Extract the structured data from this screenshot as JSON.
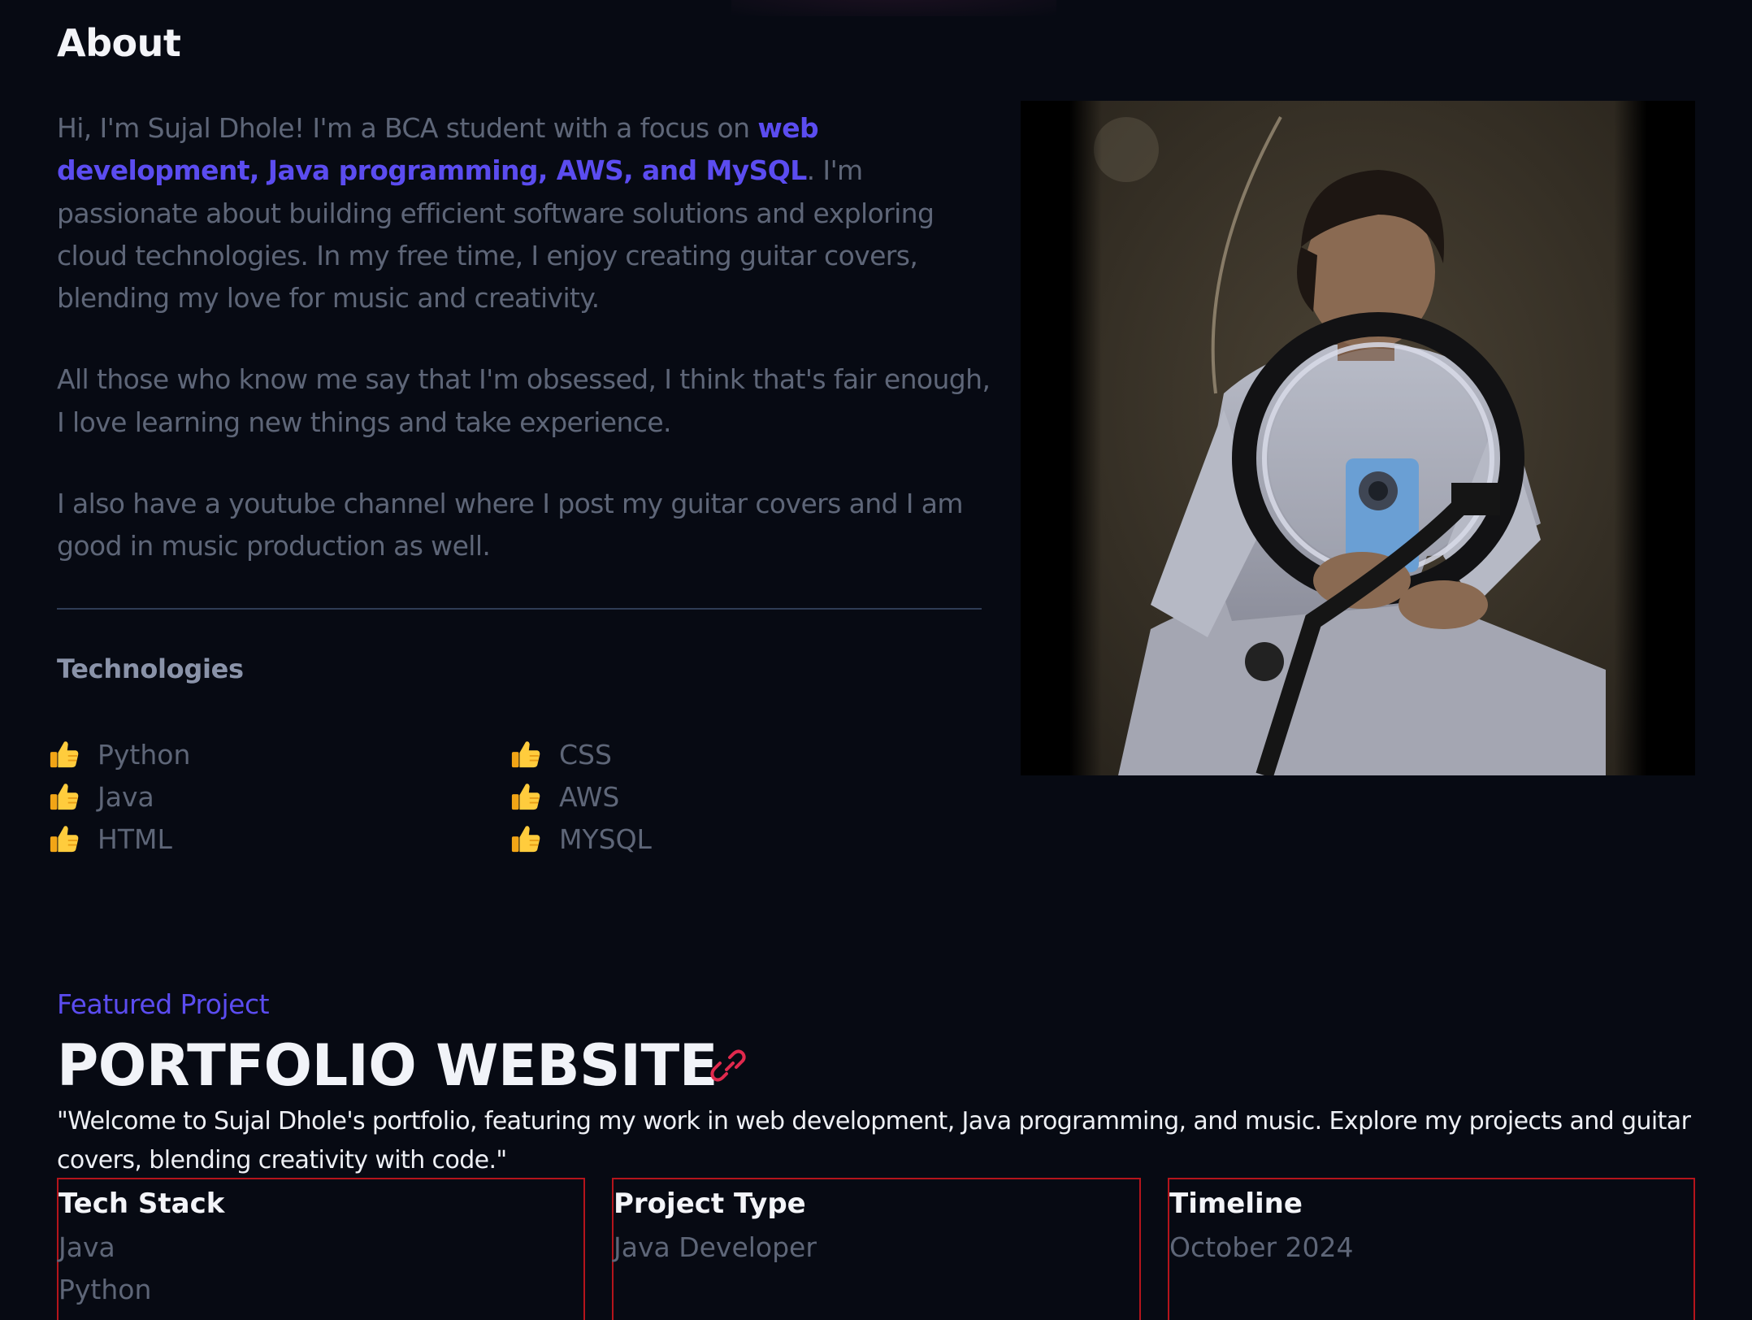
{
  "about": {
    "title": "About",
    "para1_start": "Hi, I'm Sujal Dhole! I'm a BCA student with a focus on ",
    "para1_highlight": "web development, Java programming, AWS, and MySQL",
    "para1_end": ". I'm passionate about building efficient software solutions and exploring cloud technologies. In my free time, I enjoy creating guitar covers, blending my love for music and creativity.",
    "para2": "All those who know me say that I'm obsessed, I think that's fair enough, I love learning new things and take experience.",
    "para3": "I also have a youtube channel where I post my guitar covers and I am good in music production as well.",
    "accent_color": "#5b4cf0"
  },
  "technologies": {
    "title": "Technologies",
    "icon": "thumbs-up-icon",
    "column1": [
      "Python",
      "Java",
      "HTML"
    ],
    "column2": [
      "CSS",
      "AWS",
      "MYSQL"
    ]
  },
  "featured": {
    "label": "Featured Project",
    "title": "PORTFOLIO WEBSITE",
    "link_icon": "link-icon",
    "link_color": "#e0294d",
    "description": "\"Welcome to Sujal Dhole's portfolio, featuring my work in web development, Java programming, and music. Explore my projects and guitar covers, blending creativity with code.\"",
    "cards": [
      {
        "title": "Tech Stack",
        "values": [
          "Java",
          "Python"
        ]
      },
      {
        "title": "Project Type",
        "values": [
          "Java Developer"
        ]
      },
      {
        "title": "Timeline",
        "values": [
          "October 2024"
        ]
      }
    ],
    "card_border_color": "#b4141b"
  }
}
